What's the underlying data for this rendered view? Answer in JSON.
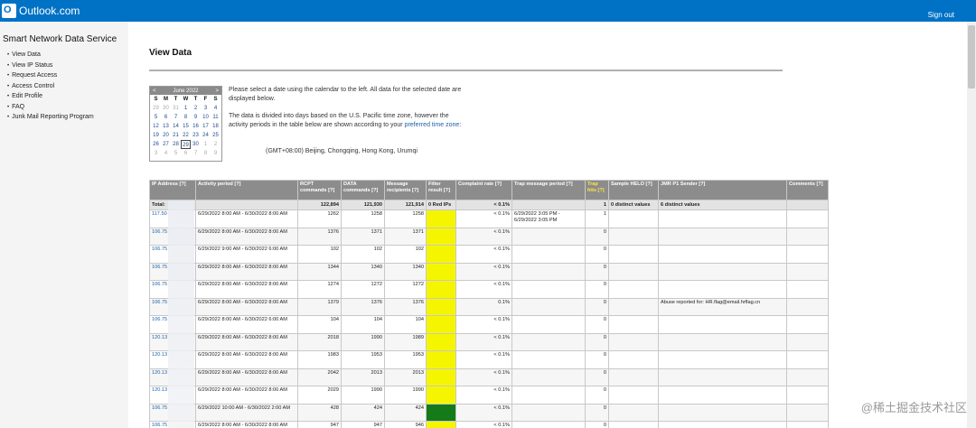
{
  "app": {
    "title": "Outlook.com",
    "signout": "Sign out"
  },
  "sidebar": {
    "title": "Smart Network Data Service",
    "items": [
      {
        "label": "View Data"
      },
      {
        "label": "View IP Status"
      },
      {
        "label": "Request Access"
      },
      {
        "label": "Access Control"
      },
      {
        "label": "Edit Profile"
      },
      {
        "label": "FAQ"
      },
      {
        "label": "Junk Mail Reporting Program"
      }
    ]
  },
  "main": {
    "title": "View Data",
    "calendar": {
      "prev": "<",
      "month": "June 2022",
      "next": ">",
      "day_headers": [
        "S",
        "M",
        "T",
        "W",
        "T",
        "F",
        "S"
      ],
      "days": [
        "29",
        "30",
        "31",
        "1",
        "2",
        "3",
        "4",
        "5",
        "6",
        "7",
        "8",
        "9",
        "10",
        "11",
        "12",
        "13",
        "14",
        "15",
        "16",
        "17",
        "18",
        "19",
        "20",
        "21",
        "22",
        "23",
        "24",
        "25",
        "26",
        "27",
        "28",
        "29",
        "30",
        "1",
        "2",
        "3",
        "4",
        "5",
        "6",
        "7",
        "8",
        "9"
      ],
      "selected": "29"
    },
    "info": {
      "p1": "Please select a date using the calendar to the left. All data for the selected date are displayed below.",
      "p2": "The data is divided into days based on the U.S. Pacific time zone, however the activity periods in the table below are shown according to your",
      "p2_link": "preferred time zone",
      "timezone": "(GMT+08:00) Beijing, Chongqing, Hong Kong, Urumqi"
    }
  },
  "table": {
    "headers": {
      "ip": "IP Address [?]",
      "period": "Activity period [?]",
      "rcpt": "RCPT commands [?]",
      "data": "DATA commands [?]",
      "msg": "Message recipients [?]",
      "filter": "Filter result [?]",
      "complaint": "Complaint rate [?]",
      "trapmsg": "Trap message period [?]",
      "traphits": "Trap hits [?]",
      "helo": "Sample HELO [?]",
      "jmr": "JMR P1 Sender [?]",
      "comments": "Comments [?]"
    },
    "total": {
      "ip": "Total:",
      "rcpt": "122,894",
      "data": "121,930",
      "msg": "121,914",
      "filter": "0 Red IPs",
      "complaint": "< 0.1%",
      "traphits": "1",
      "helo": "0 distinct values",
      "jmr": "6 distinct values"
    },
    "rows": [
      {
        "ip": "117.50",
        "period": "6/29/2022 8:00 AM - 6/30/2022 8:00 AM",
        "rcpt": "1262",
        "data": "1258",
        "msg": "1258",
        "filter_color": "yellow",
        "complaint": "< 0.1%",
        "trapmsg": "6/29/2022 3:05 PM - 6/29/2022 3:05 PM",
        "traphits": "1",
        "jmr": ""
      },
      {
        "ip": "106.75",
        "period": "6/29/2022 8:00 AM - 6/30/2022 8:00 AM",
        "rcpt": "1376",
        "data": "1371",
        "msg": "1371",
        "filter_color": "yellow",
        "complaint": "< 0.1%",
        "trapmsg": "",
        "traphits": "0",
        "jmr": ""
      },
      {
        "ip": "106.75",
        "period": "6/29/2022 9:00 AM - 6/30/2022 6:00 AM",
        "rcpt": "102",
        "data": "102",
        "msg": "102",
        "filter_color": "yellow",
        "complaint": "< 0.1%",
        "trapmsg": "",
        "traphits": "0",
        "jmr": ""
      },
      {
        "ip": "106.75",
        "period": "6/29/2022 8:00 AM - 6/30/2022 8:00 AM",
        "rcpt": "1344",
        "data": "1340",
        "msg": "1340",
        "filter_color": "yellow",
        "complaint": "< 0.1%",
        "trapmsg": "",
        "traphits": "0",
        "jmr": ""
      },
      {
        "ip": "106.75",
        "period": "6/29/2022 8:00 AM - 6/30/2022 8:00 AM",
        "rcpt": "1274",
        "data": "1272",
        "msg": "1272",
        "filter_color": "yellow",
        "complaint": "< 0.1%",
        "trapmsg": "",
        "traphits": "0",
        "jmr": ""
      },
      {
        "ip": "106.75",
        "period": "6/29/2022 8:00 AM - 6/30/2022 8:00 AM",
        "rcpt": "1379",
        "data": "1376",
        "msg": "1376",
        "filter_color": "yellow",
        "complaint": "0.1%",
        "trapmsg": "",
        "traphits": "0",
        "jmr": "Abuse reported for: HR.flag@email.hrflag.cn"
      },
      {
        "ip": "106.75",
        "period": "6/29/2022 8:00 AM - 6/30/2022 6:00 AM",
        "rcpt": "104",
        "data": "104",
        "msg": "104",
        "filter_color": "yellow",
        "complaint": "< 0.1%",
        "trapmsg": "",
        "traphits": "0",
        "jmr": ""
      },
      {
        "ip": "120.13",
        "period": "6/29/2022 8:00 AM - 6/30/2022 8:00 AM",
        "rcpt": "2018",
        "data": "1990",
        "msg": "1989",
        "filter_color": "yellow",
        "complaint": "< 0.1%",
        "trapmsg": "",
        "traphits": "0",
        "jmr": ""
      },
      {
        "ip": "120.13",
        "period": "6/29/2022 8:00 AM - 6/30/2022 8:00 AM",
        "rcpt": "1983",
        "data": "1953",
        "msg": "1953",
        "filter_color": "yellow",
        "complaint": "< 0.1%",
        "trapmsg": "",
        "traphits": "0",
        "jmr": ""
      },
      {
        "ip": "120.13",
        "period": "6/29/2022 8:00 AM - 6/30/2022 8:00 AM",
        "rcpt": "2042",
        "data": "2013",
        "msg": "2013",
        "filter_color": "yellow",
        "complaint": "< 0.1%",
        "trapmsg": "",
        "traphits": "0",
        "jmr": ""
      },
      {
        "ip": "120.13",
        "period": "6/29/2022 8:00 AM - 6/30/2022 8:00 AM",
        "rcpt": "2029",
        "data": "1990",
        "msg": "1990",
        "filter_color": "yellow",
        "complaint": "< 0.1%",
        "trapmsg": "",
        "traphits": "0",
        "jmr": ""
      },
      {
        "ip": "106.75",
        "period": "6/29/2022 10:00 AM - 6/30/2022 2:00 AM",
        "rcpt": "428",
        "data": "424",
        "msg": "424",
        "filter_color": "green",
        "complaint": "< 0.1%",
        "trapmsg": "",
        "traphits": "0",
        "jmr": ""
      },
      {
        "ip": "106.75",
        "period": "6/29/2022 8:00 AM - 6/30/2022 8:00 AM",
        "rcpt": "947",
        "data": "947",
        "msg": "946",
        "filter_color": "yellow",
        "complaint": "< 0.1%",
        "trapmsg": "",
        "traphits": "0",
        "jmr": ""
      }
    ]
  },
  "watermark": "@稀土掘金技术社区",
  "colors": {
    "topbar": "#0072c6",
    "filter_yellow": "#f5f500",
    "filter_green": "#157b18",
    "header_gray": "#8c8c8c"
  }
}
